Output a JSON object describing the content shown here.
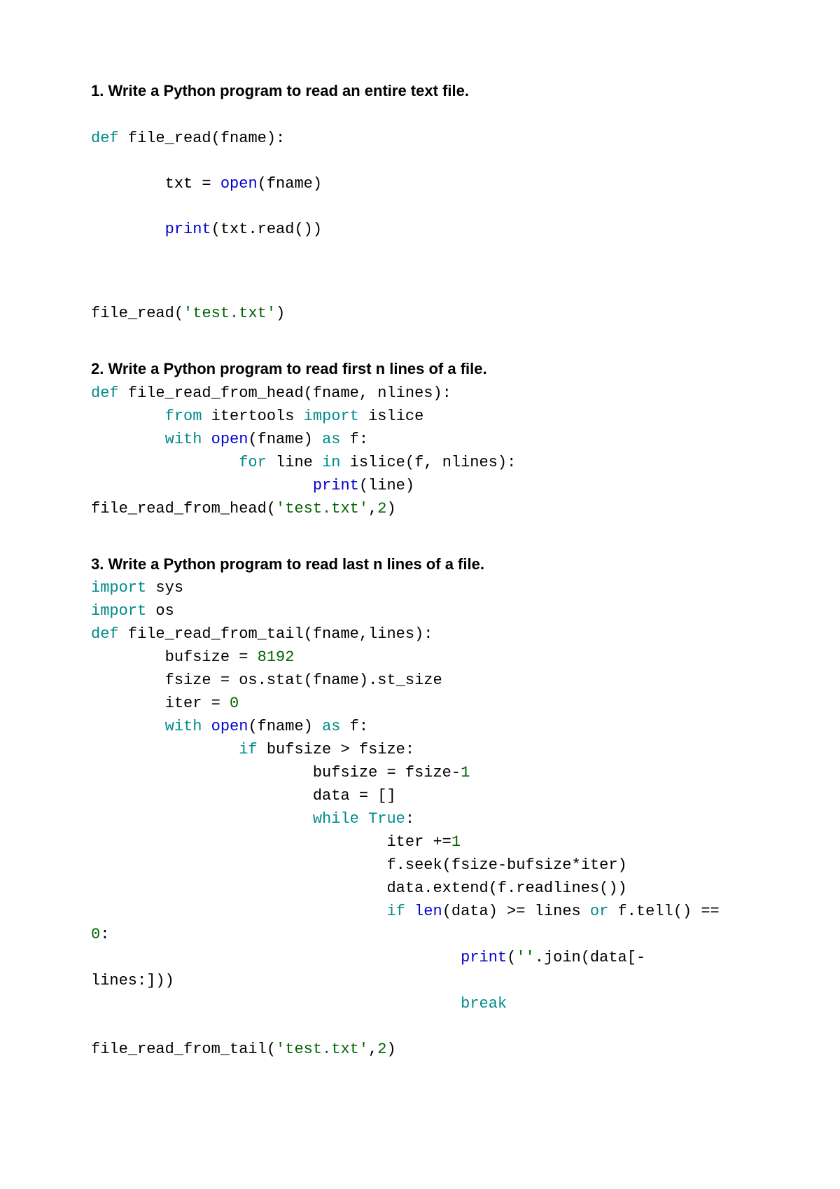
{
  "section1": {
    "heading": "1. Write a Python program to read an entire text file.",
    "l1_def": "def",
    "l1_rest": " file_read(fname):",
    "l2_pre": "        txt = ",
    "l2_open": "open",
    "l2_post": "(fname)",
    "l3_pre": "        ",
    "l3_print": "print",
    "l3_post": "(txt.read())",
    "l4_pre": "file_read(",
    "l4_str": "'test.txt'",
    "l4_post": ")"
  },
  "section2": {
    "heading": "2. Write a Python program to read first n lines of a file.",
    "l1_def": "def",
    "l1_rest": " file_read_from_head(fname, nlines):",
    "l2_pre": "        ",
    "l2_from": "from",
    "l2_mid": " itertools ",
    "l2_import": "import",
    "l2_post": " islice",
    "l3_pre": "        ",
    "l3_with": "with",
    "l3_mid": " ",
    "l3_open": "open",
    "l3_mid2": "(fname) ",
    "l3_as": "as",
    "l3_post": " f:",
    "l4_pre": "                ",
    "l4_for": "for",
    "l4_mid": " line ",
    "l4_in": "in",
    "l4_post": " islice(f, nlines):",
    "l5_pre": "                        ",
    "l5_print": "print",
    "l5_post": "(line)",
    "l6_pre": "file_read_from_head(",
    "l6_str": "'test.txt'",
    "l6_mid": ",",
    "l6_num": "2",
    "l6_post": ")"
  },
  "section3": {
    "heading": "3. Write a Python program to read last n lines of a file.",
    "l1_import": "import",
    "l1_post": " sys",
    "l2_import": "import",
    "l2_post": " os",
    "l3_def": "def",
    "l3_post": " file_read_from_tail(fname,lines):",
    "l4_pre": "        bufsize = ",
    "l4_num": "8192",
    "l5": "        fsize = os.stat(fname).st_size",
    "l6_pre": "        iter = ",
    "l6_num": "0",
    "l7_pre": "        ",
    "l7_with": "with",
    "l7_mid": " ",
    "l7_open": "open",
    "l7_mid2": "(fname) ",
    "l7_as": "as",
    "l7_post": " f:",
    "l8_pre": "                ",
    "l8_if": "if",
    "l8_post": " bufsize > fsize:",
    "l9_pre": "                        bufsize = fsize-",
    "l9_num": "1",
    "l10": "                        data = []",
    "l11_pre": "                        ",
    "l11_while": "while",
    "l11_mid": " ",
    "l11_true": "True",
    "l11_post": ":",
    "l12_pre": "                                iter +=",
    "l12_num": "1",
    "l13": "                                f.seek(fsize-bufsize*iter)",
    "l14": "                                data.extend(f.readlines())",
    "l15_pre": "                                ",
    "l15_if": "if",
    "l15_mid": " ",
    "l15_len": "len",
    "l15_mid2": "(data) >= lines ",
    "l15_or": "or",
    "l15_post": " f.tell() == ",
    "l16_num": "0",
    "l16_post": ":",
    "l17_pre": "                                        ",
    "l17_print": "print",
    "l17_mid": "(",
    "l17_str": "''",
    "l17_post": ".join(data[-",
    "l18": "lines:]))",
    "l19_pre": "                                        ",
    "l19_break": "break",
    "l20_pre": "file_read_from_tail(",
    "l20_str": "'test.txt'",
    "l20_mid": ",",
    "l20_num": "2",
    "l20_post": ")"
  }
}
